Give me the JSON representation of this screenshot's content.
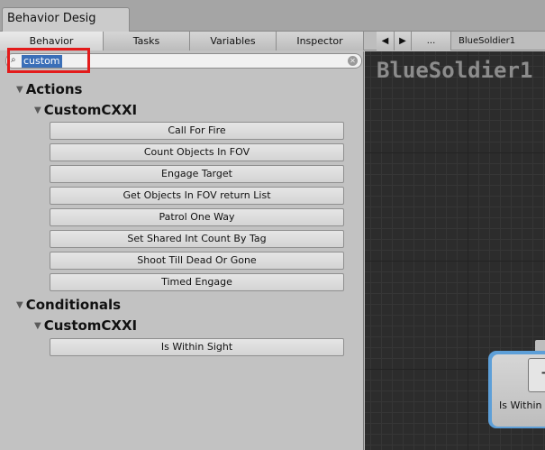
{
  "window": {
    "tab_title": "Behavior Desig"
  },
  "subtabs": [
    {
      "label": "Behavior",
      "active": true
    },
    {
      "label": "Tasks",
      "active": false
    },
    {
      "label": "Variables",
      "active": false
    },
    {
      "label": "Inspector",
      "active": false
    }
  ],
  "nav": {
    "back_icon": "◀",
    "forward_icon": "▶",
    "more_label": "...",
    "document_label": "BlueSoldier1"
  },
  "search": {
    "value": "custom",
    "icon": "search-icon",
    "clear_icon": "clear-icon"
  },
  "tree": {
    "actions_label": "Actions",
    "actions_group_label": "CustomCXXI",
    "actions": [
      "Call For Fire",
      "Count Objects In FOV",
      "Engage Target",
      "Get Objects In FOV  return List",
      "Patrol One Way",
      "Set Shared Int  Count By Tag",
      "Shoot Till Dead Or Gone",
      "Timed Engage"
    ],
    "conditionals_label": "Conditionals",
    "conditionals_group_label": "CustomCXXI",
    "conditionals": [
      "Is Within Sight"
    ]
  },
  "graph": {
    "title": "BlueSoldier1",
    "node_label": "Is Within Sight"
  },
  "colors": {
    "highlight": "#e31b1b",
    "selection": "#3a6fb8",
    "node_glow": "#5d9fd8",
    "graph_bg": "#2c2c2c"
  }
}
